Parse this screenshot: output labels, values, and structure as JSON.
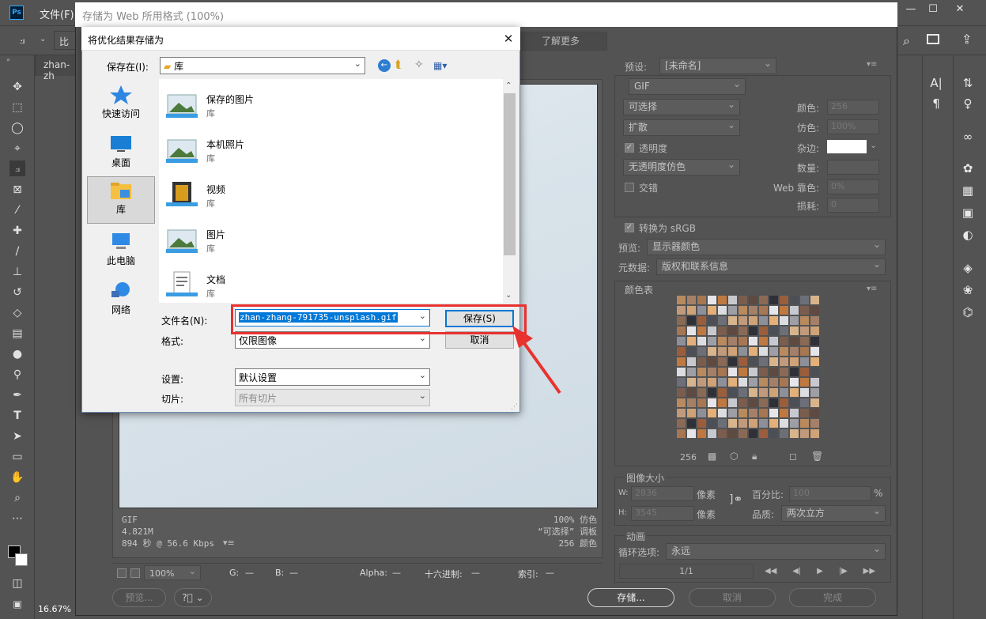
{
  "ps": {
    "logo": "Ps",
    "menu_file": "文件(F)",
    "crop_tool_partial": "比",
    "doc_tab": "zhan-zh",
    "zoom": "16.67%",
    "window_controls": [
      "—",
      "☐",
      "✕"
    ]
  },
  "sfw": {
    "title": "存储为 Web 所用格式 (100%)",
    "learn_more": "了解更多",
    "preview_info": {
      "format": "GIF",
      "size": "4.821M",
      "time": "894 秒 @ 56.6 Kbps",
      "quality": "100% 仿色",
      "palette": "“可选择” 调板",
      "colors": "256 颜色"
    },
    "status": {
      "zoom": "100%",
      "g_label": "G:",
      "g_val": "—",
      "b_label": "B:",
      "b_val": "—",
      "alpha_label": "Alpha:",
      "alpha_val": "—",
      "hex_label": "十六进制:",
      "hex_val": "—",
      "index_label": "索引:",
      "index_val": "—"
    },
    "bottom": {
      "preview": "预览...",
      "save": "存储...",
      "cancel": "取消",
      "done": "完成"
    },
    "settings": {
      "preset_label": "预设:",
      "preset_value": "[未命名]",
      "format": "GIF",
      "reduction": "可选择",
      "dither": "扩散",
      "transparency_label": "透明度",
      "transparency_dither": "无透明度仿色",
      "interlaced_label": "交错",
      "colors_label": "颜色:",
      "colors_value": "256",
      "dither_label": "仿色:",
      "dither_value": "100%",
      "matte_label": "杂边:",
      "amount_label": "数量:",
      "web_snap_label": "Web 靠色:",
      "web_snap_value": "0%",
      "lossy_label": "损耗:",
      "lossy_value": "0",
      "convert_srgb_label": "转换为 sRGB",
      "preview_label": "预览:",
      "preview_value": "显示器颜色",
      "metadata_label": "元数据:",
      "metadata_value": "版权和联系信息"
    },
    "color_table": {
      "title": "颜色表",
      "count": "256"
    },
    "image_size": {
      "title": "图像大小",
      "w_label": "W:",
      "w_value": "2836",
      "h_label": "H:",
      "h_value": "3545",
      "unit": "像素",
      "percent_label": "百分比:",
      "percent_value": "100",
      "percent_unit": "%",
      "quality_label": "品质:",
      "quality_value": "两次立方"
    },
    "animation": {
      "title": "动画",
      "loop_label": "循环选项:",
      "loop_value": "永远",
      "frame": "1/1"
    }
  },
  "file_dialog": {
    "title": "将优化结果存储为",
    "save_in_label": "保存在(I):",
    "save_in_value": "库",
    "places": [
      "快速访问",
      "桌面",
      "库",
      "此电脑",
      "网络"
    ],
    "items": [
      {
        "name": "保存的图片",
        "sub": "库"
      },
      {
        "name": "本机照片",
        "sub": "库"
      },
      {
        "name": "视频",
        "sub": "库"
      },
      {
        "name": "图片",
        "sub": "库"
      },
      {
        "name": "文档",
        "sub": "库"
      }
    ],
    "filename_label": "文件名(N):",
    "filename_value": "zhan-zhang-791735-unsplash.gif",
    "format_label": "格式:",
    "format_value": "仅限图像",
    "settings_label": "设置:",
    "settings_value": "默认设置",
    "slices_label": "切片:",
    "slices_value": "所有切片",
    "save_button": "保存(S)",
    "cancel_button": "取消"
  },
  "colors": {
    "accent_blue": "#0078d7",
    "highlight_red": "#e8322f",
    "panel_bg": "#535353"
  }
}
